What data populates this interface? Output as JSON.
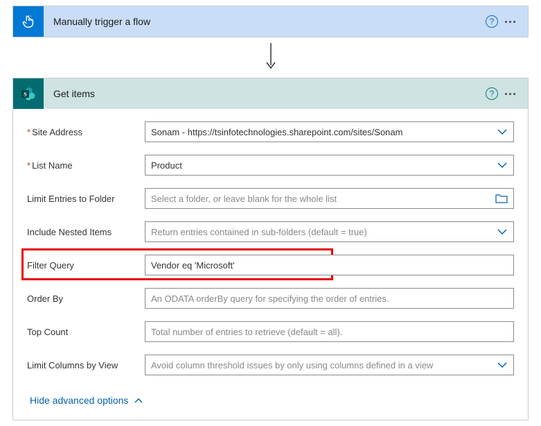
{
  "trigger": {
    "title": "Manually trigger a flow",
    "iconName": "touch-icon"
  },
  "action": {
    "title": "Get items",
    "iconName": "sharepoint-icon",
    "fields": {
      "siteAddress": {
        "label": "Site Address",
        "value": "Sonam - https://tsinfotechnologies.sharepoint.com/sites/Sonam"
      },
      "listName": {
        "label": "List Name",
        "value": "Product"
      },
      "limitFolder": {
        "label": "Limit Entries to Folder",
        "placeholder": "Select a folder, or leave blank for the whole list"
      },
      "includeNested": {
        "label": "Include Nested Items",
        "placeholder": "Return entries contained in sub-folders (default = true)"
      },
      "filterQuery": {
        "label": "Filter Query",
        "value": "Vendor eq 'Microsoft'"
      },
      "orderBy": {
        "label": "Order By",
        "placeholder": "An ODATA orderBy query for specifying the order of entries."
      },
      "topCount": {
        "label": "Top Count",
        "placeholder": "Total number of entries to retrieve (default = all)."
      },
      "limitColumns": {
        "label": "Limit Columns by View",
        "placeholder": "Avoid column threshold issues by only using columns defined in a view"
      }
    },
    "advancedLinkLabel": "Hide advanced options"
  }
}
